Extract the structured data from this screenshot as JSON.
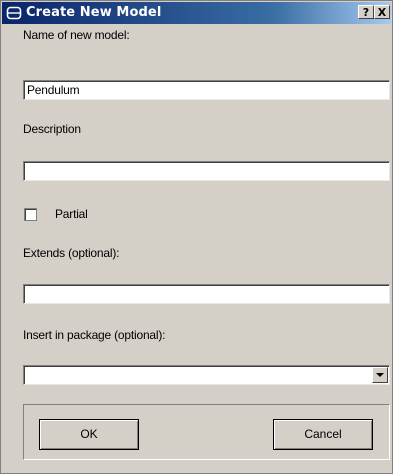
{
  "window": {
    "title": "Create New Model",
    "help_button": "?",
    "close_button": "X"
  },
  "form": {
    "name_label": "Name of new model:",
    "name_value": "Pendulum",
    "description_label": "Description",
    "description_value": "",
    "partial_label": "Partial",
    "partial_checked": false,
    "extends_label": "Extends (optional):",
    "extends_value": "",
    "package_label": "Insert in package (optional):",
    "package_value": ""
  },
  "buttons": {
    "ok_label": "OK",
    "cancel_label": "Cancel"
  },
  "icons": {
    "title_icon": "model-icon",
    "combo_arrow": "chevron-down-icon"
  },
  "colors": {
    "titlebar_start": "#0a246a",
    "titlebar_end": "#a6caf0",
    "dialog_bg": "#d4d0c8"
  }
}
